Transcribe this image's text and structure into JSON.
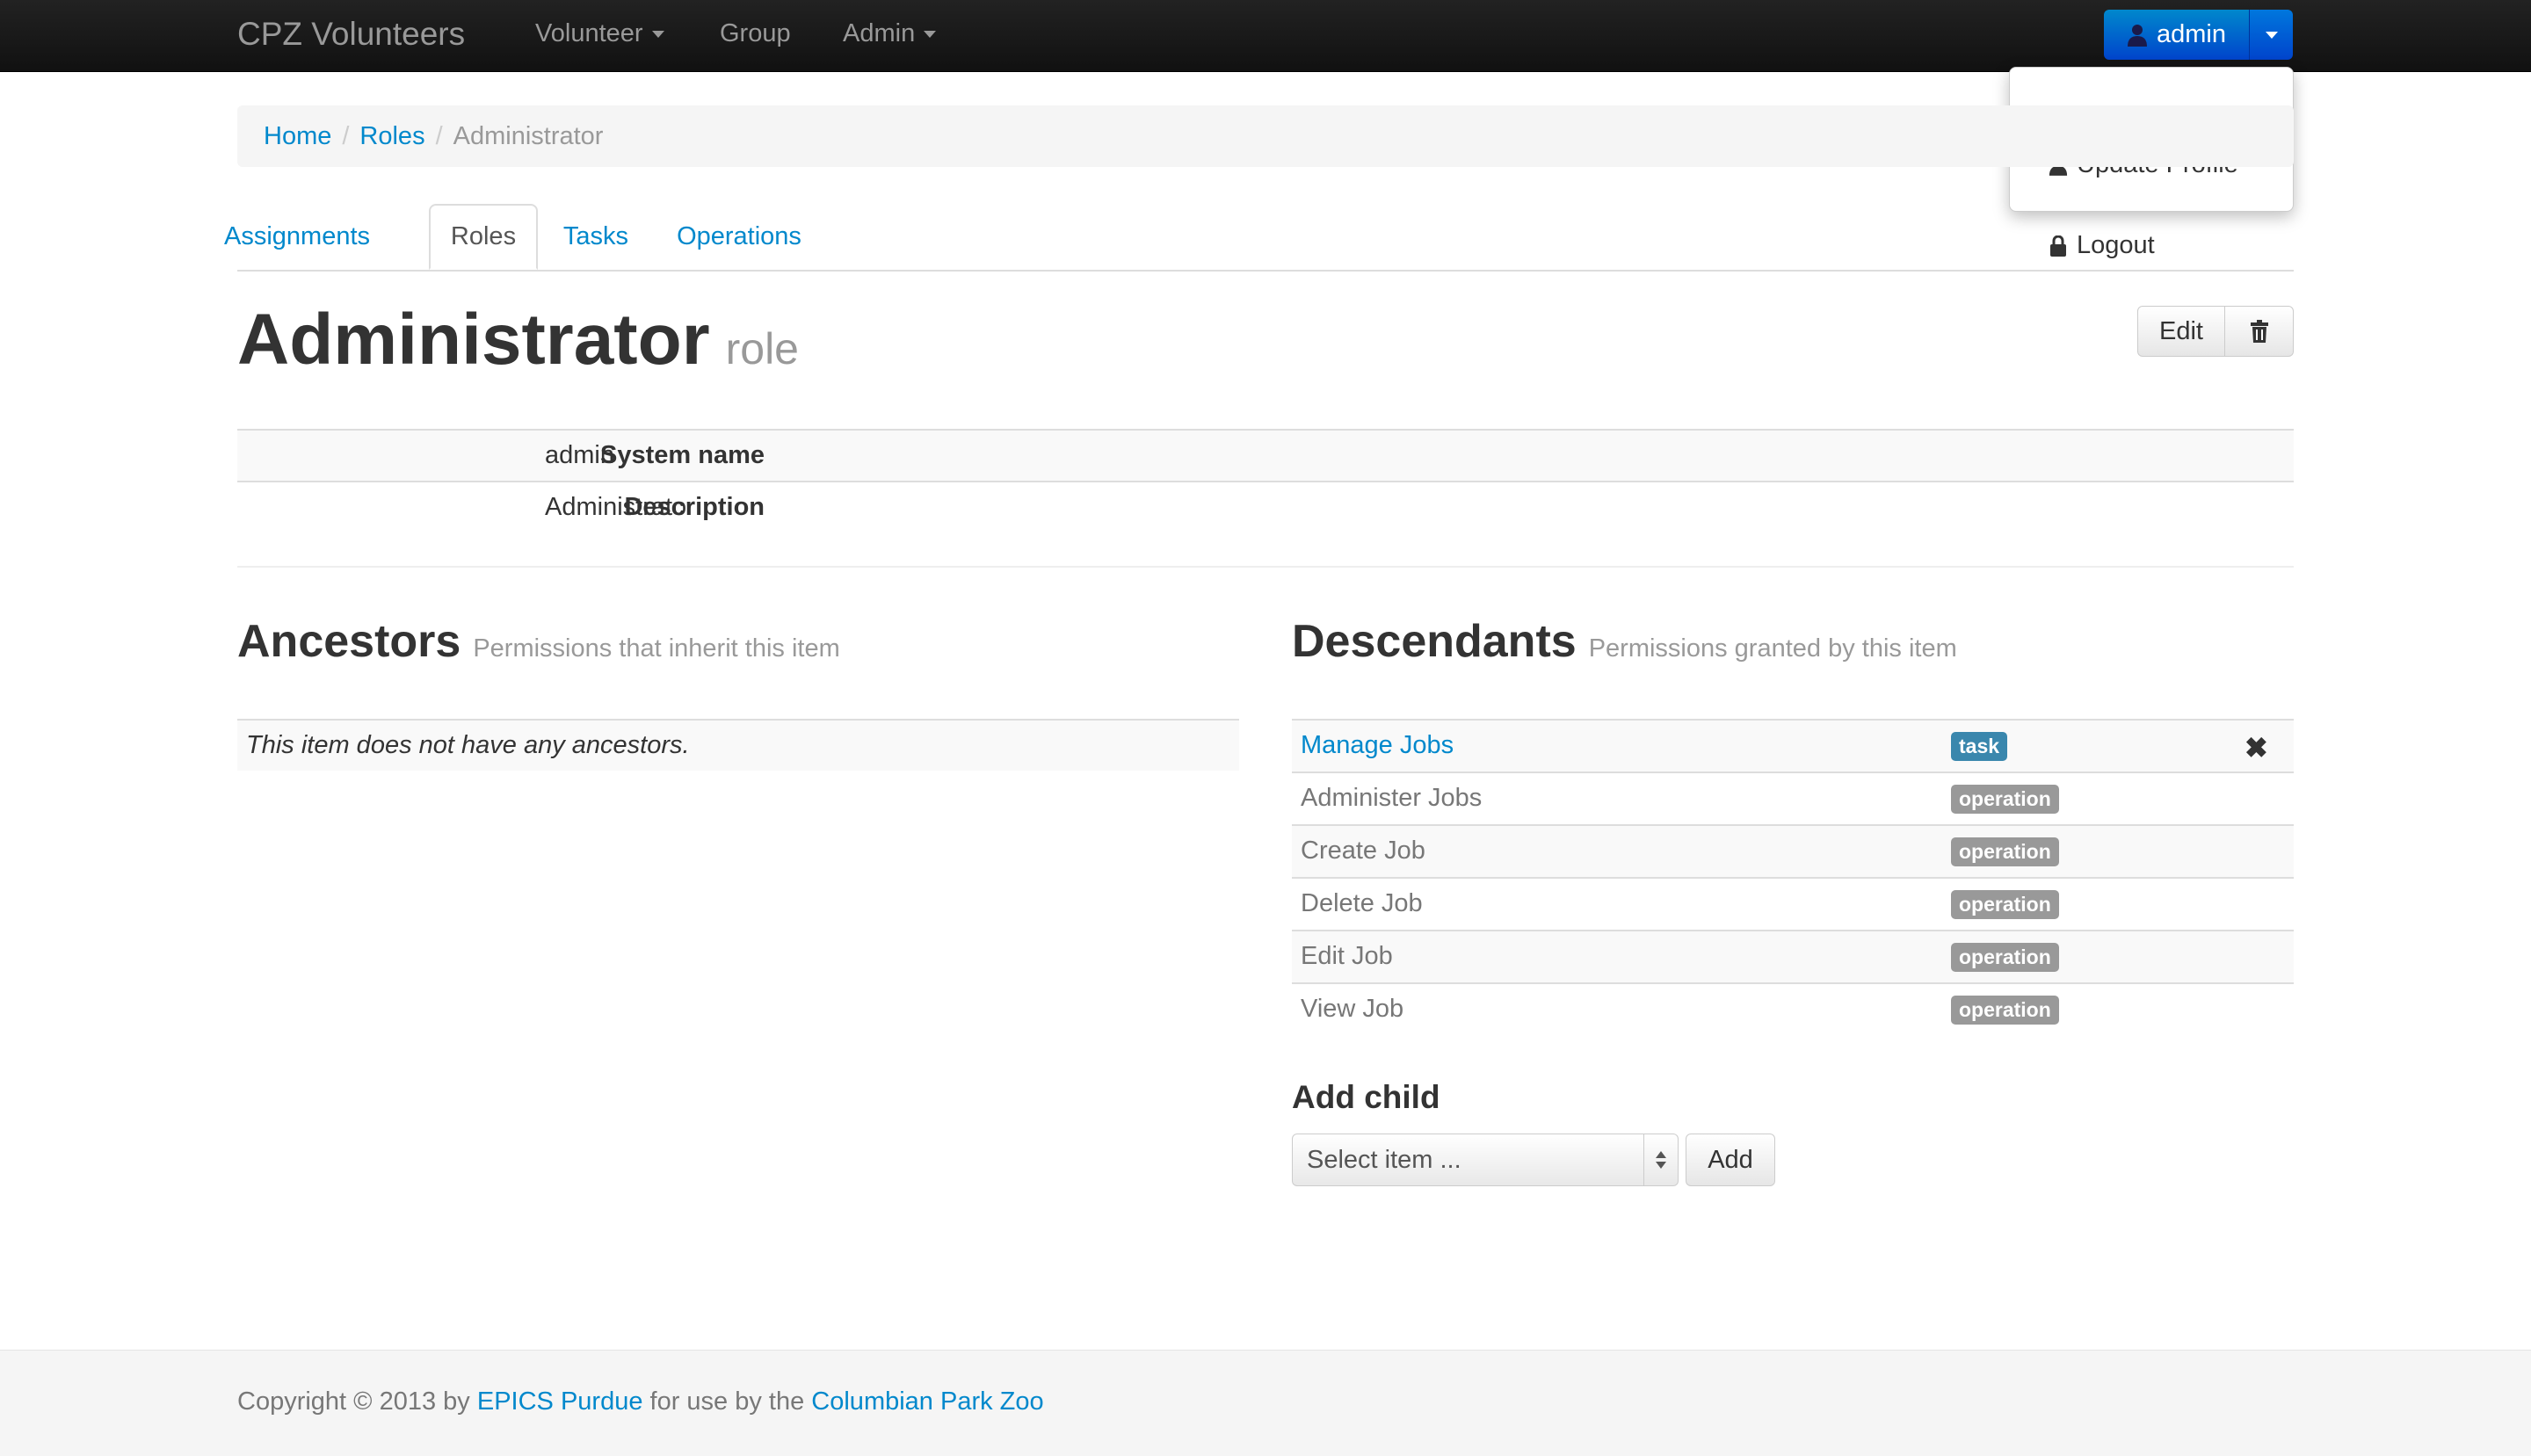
{
  "navbar": {
    "brand": "CPZ Volunteers",
    "items": [
      {
        "label": "Volunteer",
        "has_caret": true
      },
      {
        "label": "Group",
        "has_caret": false
      },
      {
        "label": "Admin",
        "has_caret": true
      }
    ],
    "user_button": "admin",
    "user_menu": [
      "Update Profile",
      "Logout"
    ]
  },
  "breadcrumb": {
    "items": [
      "Home",
      "Roles"
    ],
    "active": "Administrator"
  },
  "tabs": [
    "Assignments",
    "Roles",
    "Tasks",
    "Operations"
  ],
  "active_tab": "Roles",
  "page": {
    "title": "Administrator",
    "subtitle": "role",
    "edit_label": "Edit"
  },
  "details": [
    {
      "label": "System name",
      "value": "admin"
    },
    {
      "label": "Description",
      "value": "Administrator"
    }
  ],
  "ancestors": {
    "title": "Ancestors",
    "subtitle": "Permissions that inherit this item",
    "empty_text": "This item does not have any ancestors."
  },
  "descendants": {
    "title": "Descendants",
    "subtitle": "Permissions granted by this item",
    "rows": [
      {
        "name": "Manage Jobs",
        "type": "task",
        "link": true
      },
      {
        "name": "Administer Jobs",
        "type": "operation",
        "link": false
      },
      {
        "name": "Create Job",
        "type": "operation",
        "link": false
      },
      {
        "name": "Delete Job",
        "type": "operation",
        "link": false
      },
      {
        "name": "Edit Job",
        "type": "operation",
        "link": false
      },
      {
        "name": "View Job",
        "type": "operation",
        "link": false
      }
    ]
  },
  "add_child": {
    "title": "Add child",
    "select_placeholder": "Select item ...",
    "button": "Add"
  },
  "footer": {
    "prefix": "Copyright © 2013 by ",
    "link1": "EPICS Purdue",
    "middle": " for use by the ",
    "link2": "Columbian Park Zoo"
  },
  "colors": {
    "link": "#0088cc",
    "primary_button": "#0044cc",
    "task_badge": "#3a87ad",
    "operation_badge": "#999999"
  }
}
